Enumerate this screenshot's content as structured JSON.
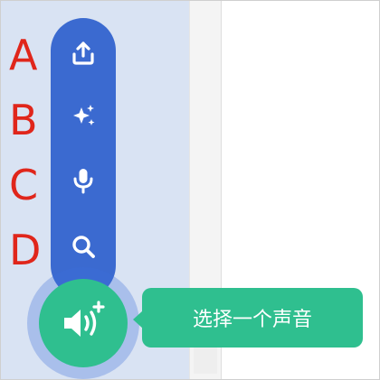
{
  "colors": {
    "panel_bg": "#d9e3f3",
    "menu_blue": "#3b6ad0",
    "fab_green": "#2fbf8f",
    "letter_red": "#e0261b"
  },
  "letters": [
    "A",
    "B",
    "C",
    "D"
  ],
  "menu": {
    "items": [
      {
        "icon": "upload-icon"
      },
      {
        "icon": "sparkle-icon"
      },
      {
        "icon": "microphone-icon"
      },
      {
        "icon": "search-icon"
      }
    ]
  },
  "fab": {
    "icon": "add-sound-icon"
  },
  "tooltip": {
    "text": "选择一个声音"
  }
}
